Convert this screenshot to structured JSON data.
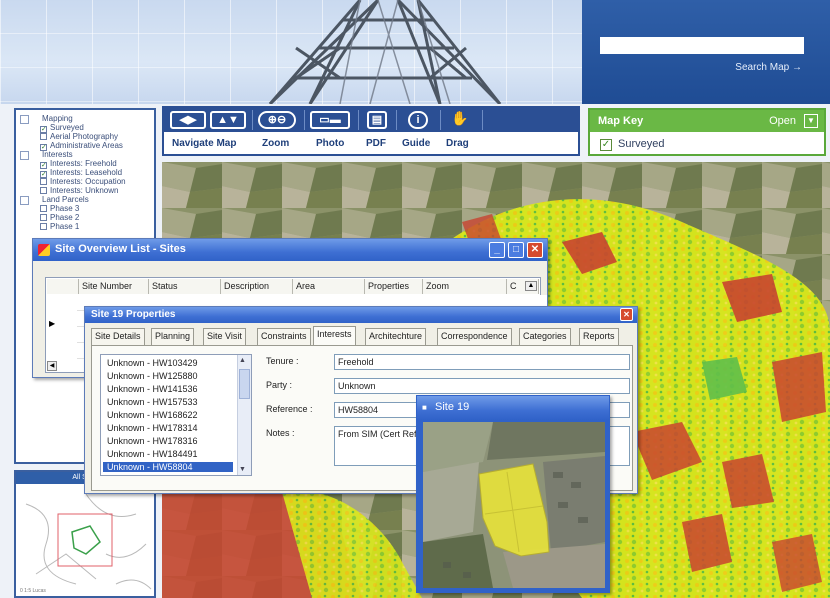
{
  "header": {
    "search_link": "Search Map →",
    "search_value": ""
  },
  "layers_panel": {
    "items": [
      {
        "label": "Mapping",
        "level": 0,
        "checked": null
      },
      {
        "label": "Surveyed",
        "level": 1,
        "checked": true
      },
      {
        "label": "Aerial Photography",
        "level": 1,
        "checked": false
      },
      {
        "label": "Administrative Areas",
        "level": 1,
        "checked": true
      },
      {
        "label": "Interests",
        "level": 0,
        "checked": null
      },
      {
        "label": "Interests: Freehold",
        "level": 1,
        "checked": true
      },
      {
        "label": "Interests: Leasehold",
        "level": 1,
        "checked": true
      },
      {
        "label": "Interests: Occupation",
        "level": 1,
        "checked": false
      },
      {
        "label": "Interests: Unknown",
        "level": 1,
        "checked": false
      },
      {
        "label": "Land Parcels",
        "level": 0,
        "checked": null
      },
      {
        "label": "Phase 3",
        "level": 1,
        "checked": false
      },
      {
        "label": "Phase 2",
        "level": 1,
        "checked": false
      },
      {
        "label": "Phase 1",
        "level": 1,
        "checked": false
      }
    ]
  },
  "mini_map": {
    "title": "All Sites",
    "scale": "0 1:5 Lucas"
  },
  "toolbar": {
    "tools": [
      {
        "label": "Navigate Map",
        "icon": "navigate-arrows-icon"
      },
      {
        "label": "Zoom",
        "icon": "zoom-icon"
      },
      {
        "label": "Photo",
        "icon": "photo-icon"
      },
      {
        "label": "PDF",
        "icon": "pdf-icon"
      },
      {
        "label": "Guide",
        "icon": "info-icon"
      },
      {
        "label": "Drag",
        "icon": "hand-icon"
      }
    ]
  },
  "map_key": {
    "title": "Map Key",
    "open_label": "Open",
    "items": [
      {
        "label": "Surveyed",
        "checked": true
      }
    ]
  },
  "overview_window": {
    "title": "Site Overview List - Sites",
    "columns": [
      "Site Number",
      "Status",
      "Description",
      "Area",
      "Properties",
      "Zoom",
      "C"
    ]
  },
  "properties_window": {
    "title": "Site 19 Properties",
    "tabs": [
      "Site Details",
      "Planning",
      "Site Visit",
      "Constraints",
      "Interests",
      "Architechture",
      "Correspondence",
      "Categories",
      "Reports"
    ],
    "active_tab": "Interests",
    "interests": [
      "Unknown - HW103429",
      "Unknown - HW125880",
      "Unknown - HW141536",
      "Unknown - HW157533",
      "Unknown - HW168622",
      "Unknown - HW178314",
      "Unknown - HW178316",
      "Unknown - HW184491",
      "Unknown - HW58804"
    ],
    "selected_interest": "Unknown - HW58804",
    "fields": {
      "tenure_label": "Tenure :",
      "tenure": "Freehold",
      "party_label": "Party :",
      "party": "Unknown",
      "reference_label": "Reference :",
      "reference": "HW58804",
      "notes_label": "Notes :",
      "notes": "From SIM (Cert Ref"
    }
  },
  "site19_window": {
    "title": "Site 19"
  }
}
